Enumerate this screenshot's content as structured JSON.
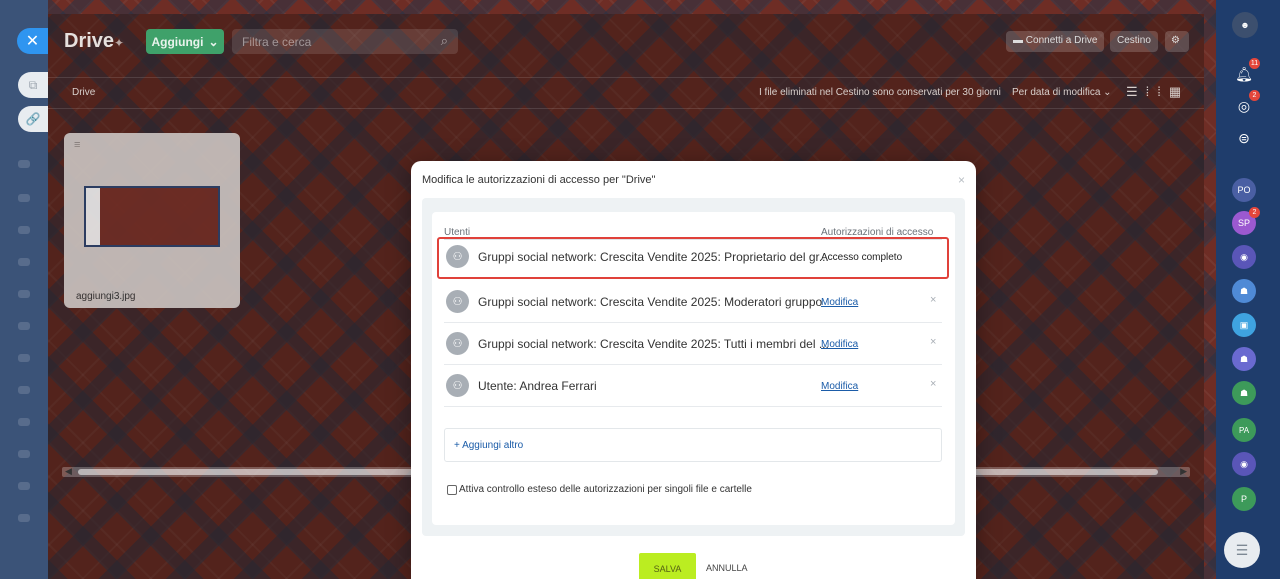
{
  "drive": {
    "title": "Drive",
    "add_label": "Aggiungi",
    "search_placeholder": "Filtra e cerca",
    "connect_label": "Connetti a Drive",
    "trash_label": "Cestino",
    "breadcrumb": "Drive",
    "retention_note": "I file eliminati nel Cestino sono conservati per 30 giorni",
    "sort_label": "Per data di modifica",
    "file_name": "aggiungi3.jpg"
  },
  "modal": {
    "title": "Modifica le autorizzazioni di accesso per \"Drive\"",
    "col_users": "Utenti",
    "col_perms": "Autorizzazioni di accesso",
    "rows": [
      {
        "name": "Gruppi social network: Crescita Vendite 2025: Proprietario del gr...",
        "perm": "Accesso completo"
      },
      {
        "name": "Gruppi social network: Crescita Vendite 2025: Moderatori gruppo",
        "perm": "Modifica"
      },
      {
        "name": "Gruppi social network: Crescita Vendite 2025: Tutti i membri del ...",
        "perm": "Modifica"
      },
      {
        "name": "Utente: Andrea Ferrari",
        "perm": "Modifica"
      }
    ],
    "add_more": "+ Aggiungi altro",
    "extended_control": "Attiva controllo esteso delle autorizzazioni per singoli file e cartelle",
    "save": "SALVA",
    "cancel": "ANNULLA"
  },
  "right_bar": {
    "notifications_count": "11",
    "activity_count": "2",
    "sp_count": "2",
    "avatars": [
      "PO",
      "SP",
      "PA",
      "P"
    ]
  },
  "colors": {
    "accent_blue": "#2f95f0",
    "add_green": "#3fa16a",
    "save_lime": "#bbed21",
    "highlight_red": "#e0413a",
    "link_blue": "#1b5ca8"
  }
}
